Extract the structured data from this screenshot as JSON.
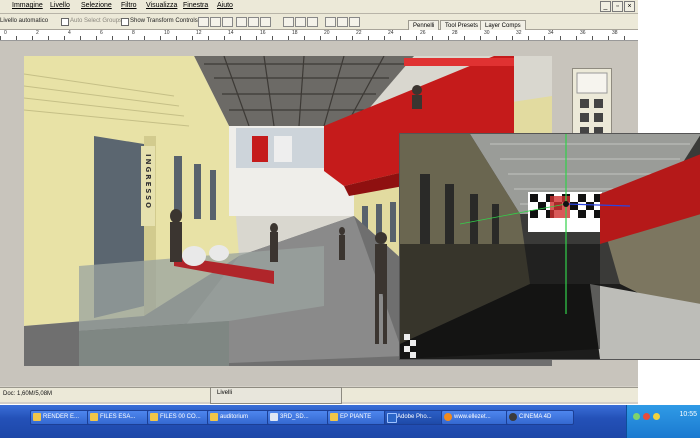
{
  "menu": {
    "items": [
      "Immagine",
      "Livello",
      "Selezione",
      "Filtro",
      "Visualizza",
      "Finestra",
      "Aiuto"
    ]
  },
  "options_bar": {
    "auto_select_layer": "Livello automatico",
    "auto_select_groups": "Auto Select Groups",
    "show_transform_controls": "Show Transform Controls"
  },
  "palette_tabs": [
    "Pennelli",
    "Tool Presets",
    "Layer Comps"
  ],
  "ruler": {
    "numbers": [
      "0",
      "2",
      "4",
      "6",
      "8",
      "10",
      "12",
      "14",
      "16",
      "18",
      "20",
      "22",
      "24",
      "26",
      "28",
      "30",
      "32",
      "34",
      "36",
      "38"
    ]
  },
  "scene": {
    "entrance_sign": "INGRESSO"
  },
  "status": {
    "doc_size": "Doc: 1,60M/5,08M"
  },
  "mini_panel": {
    "label": "Livelli"
  },
  "taskbar": {
    "buttons": [
      {
        "label": "RENDER E...",
        "color": "#f2c649"
      },
      {
        "label": "FILES ESA...",
        "color": "#f2c649"
      },
      {
        "label": "FILES 00 CO...",
        "color": "#f2c649"
      },
      {
        "label": "auditorium",
        "color": "#f2c649"
      },
      {
        "label": "3RD_SD...",
        "color": "#dfe6f3"
      },
      {
        "label": "EP PIANTE",
        "color": "#f2c649"
      },
      {
        "label": "Adobe Pho...",
        "color": "#2b66c8"
      },
      {
        "label": "www.ellezet...",
        "color": "#f28a1d"
      },
      {
        "label": "CINEMA 4D",
        "color": "#3b3b3b"
      }
    ],
    "clock": "10:55"
  },
  "colors": {
    "wall_yellow": "#e8e2a6",
    "red_balcony": "#c51b1b",
    "floor_gray": "#6f6f6f",
    "taskbar_blue": "#2451b8"
  }
}
